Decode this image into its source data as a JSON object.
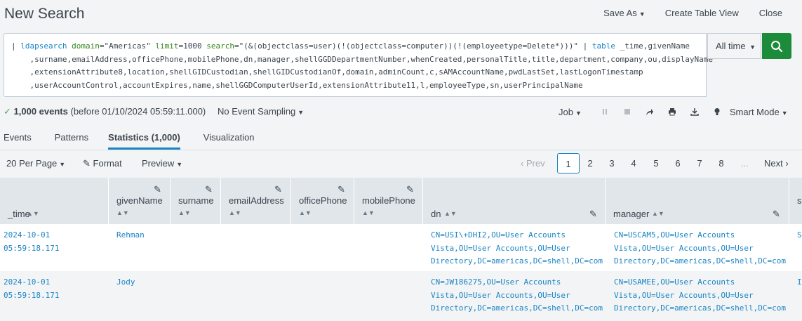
{
  "header": {
    "title": "New Search",
    "save_as": "Save As",
    "create_table_view": "Create Table View",
    "close": "Close"
  },
  "search": {
    "lines": [
      {
        "prefix": "| ",
        "cmd": "ldapsearch",
        "parts": [
          " ",
          "domain",
          "=\"Americas\" ",
          "limit",
          "=1000 ",
          "search",
          "=\"(&(objectclass=user)(!(objectclass=computer))(!(employeetype=Delete*)))\" | ",
          "table",
          " _time,givenName"
        ]
      },
      {
        "text": "    ,surname,emailAddress,officePhone,mobilePhone,dn,manager,shellGGDDepartmentNumber,whenCreated,personalTitle,title,department,company,ou,displayName"
      },
      {
        "text": "    ,extensionAttribute8,location,shellGIDCustodian,shellGIDCustodianOf,domain,adminCount,c,sAMAccountName,pwdLastSet,lastLogonTimestamp"
      },
      {
        "text": "    ,userAccountControl,accountExpires,name,shellGGDComputerUserId,extensionAttribute11,l,employeeType,sn,userPrincipalName"
      }
    ],
    "time_range": "All time"
  },
  "status": {
    "events": "1,000 events",
    "before": "(before 01/10/2024 05:59:11.000)",
    "sampling": "No Event Sampling",
    "job": "Job",
    "mode": "Smart Mode"
  },
  "tabs": [
    "Events",
    "Patterns",
    "Statistics (1,000)",
    "Visualization"
  ],
  "toolbar": {
    "per_page": "20 Per Page",
    "format": "Format",
    "preview": "Preview",
    "prev": "Prev",
    "pages": [
      "1",
      "2",
      "3",
      "4",
      "5",
      "6",
      "7",
      "8"
    ],
    "ellipsis": "...",
    "next": "Next"
  },
  "table": {
    "columns": [
      "_time",
      "givenName",
      "surname",
      "emailAddress",
      "officePhone",
      "mobilePhone",
      "dn",
      "manager",
      "s"
    ],
    "rows": [
      {
        "time": "2024-10-01\n05:59:18.171",
        "givenName": "Rehman",
        "dn": "CN=USI\\+DHI2,OU=User Accounts\nVista,OU=User Accounts,OU=User\nDirectory,DC=americas,DC=shell,DC=com",
        "manager": "CN=USCAM5,OU=User Accounts\nVista,OU=User Accounts,OU=User\nDirectory,DC=americas,DC=shell,DC=com",
        "s": "S"
      },
      {
        "time": "2024-10-01\n05:59:18.171",
        "givenName": "Jody",
        "dn": "CN=JW186275,OU=User Accounts\nVista,OU=User Accounts,OU=User\nDirectory,DC=americas,DC=shell,DC=com",
        "manager": "CN=USAMEE,OU=User Accounts\nVista,OU=User Accounts,OU=User\nDirectory,DC=americas,DC=shell,DC=com",
        "s": "I"
      }
    ]
  },
  "colors": {
    "accent": "#1a84c5",
    "search_button": "#1c8c3a",
    "success": "#54a353"
  }
}
